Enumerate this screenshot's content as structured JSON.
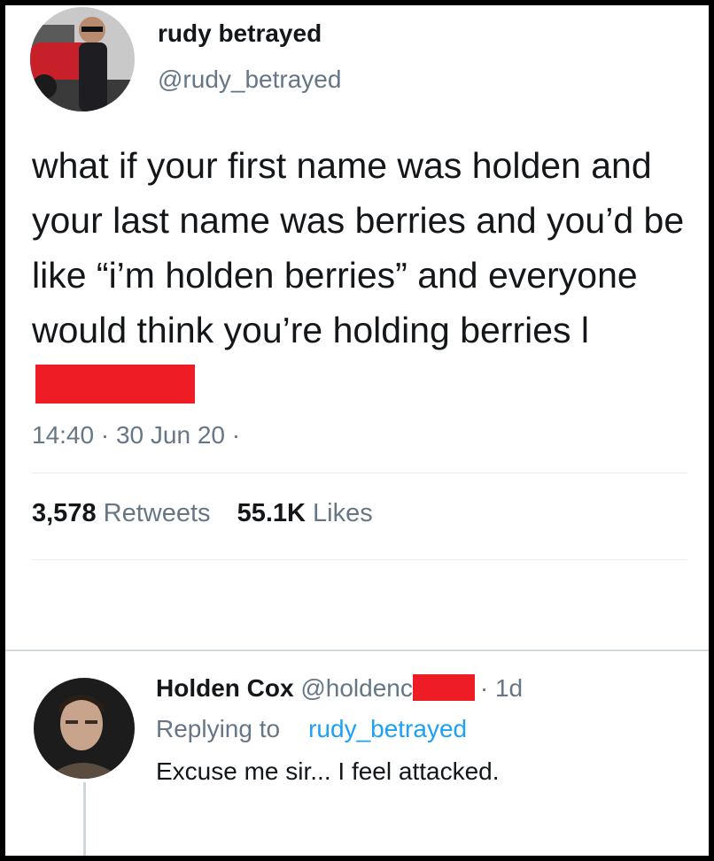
{
  "tweet": {
    "display_name": "rudy betrayed",
    "handle": "@rudy_betrayed",
    "text": "what if your first name was holden and your last name was berries and you’d be like “i’m holden berries” and everyone would think you’re holding berries l",
    "time": "14:40",
    "date": "30 Jun 20",
    "meta_sep": " · ",
    "meta_tail": " ·",
    "retweets_count": "3,578",
    "retweets_label": "Retweets",
    "likes_count": "55.1K",
    "likes_label": "Likes"
  },
  "reply": {
    "display_name": "Holden Cox",
    "handle_prefix": "@holdenc",
    "age": "· 1d",
    "replying_label": "Replying to",
    "replying_handle": "rudy_betrayed",
    "text": "Excuse me sir... I feel attacked."
  },
  "colors": {
    "redaction": "#ee1c25",
    "link": "#1da1f2",
    "secondary_text": "#657786"
  },
  "icons": {
    "avatar_1": "profile-photo-man-sunglasses-red-car",
    "avatar_2": "profile-photo-young-man"
  }
}
